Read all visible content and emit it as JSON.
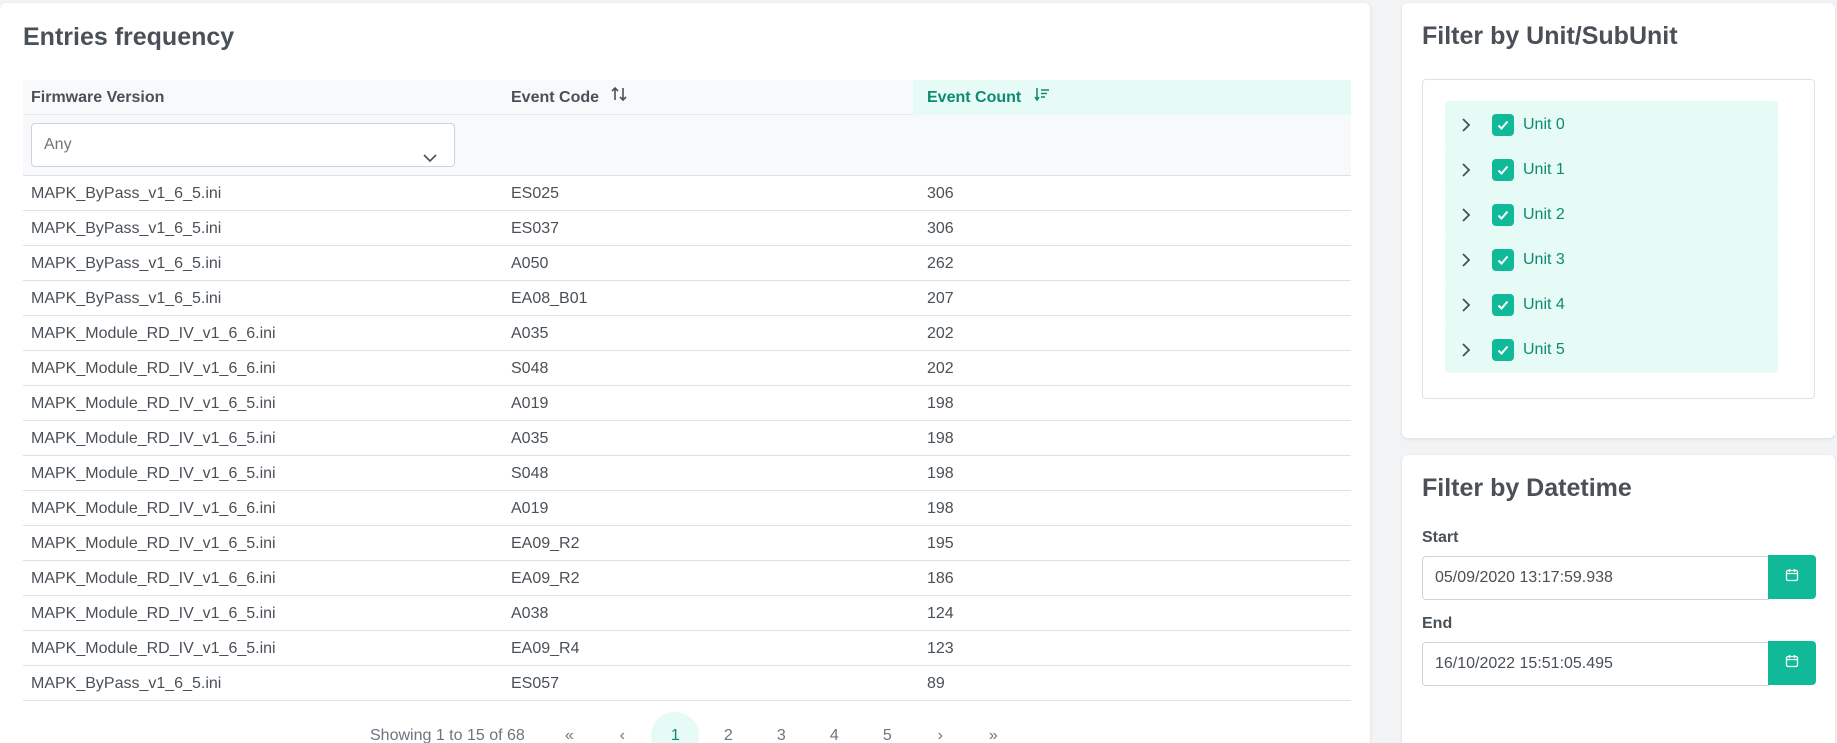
{
  "main": {
    "title": "Entries frequency",
    "columns": [
      "Firmware Version",
      "Event Code",
      "Event Count"
    ],
    "filter_value": "Any",
    "rows": [
      {
        "firmware": "MAPK_ByPass_v1_6_5.ini",
        "code": "ES025",
        "count": "306"
      },
      {
        "firmware": "MAPK_ByPass_v1_6_5.ini",
        "code": "ES037",
        "count": "306"
      },
      {
        "firmware": "MAPK_ByPass_v1_6_5.ini",
        "code": "A050",
        "count": "262"
      },
      {
        "firmware": "MAPK_ByPass_v1_6_5.ini",
        "code": "EA08_B01",
        "count": "207"
      },
      {
        "firmware": "MAPK_Module_RD_IV_v1_6_6.ini",
        "code": "A035",
        "count": "202"
      },
      {
        "firmware": "MAPK_Module_RD_IV_v1_6_6.ini",
        "code": "S048",
        "count": "202"
      },
      {
        "firmware": "MAPK_Module_RD_IV_v1_6_5.ini",
        "code": "A019",
        "count": "198"
      },
      {
        "firmware": "MAPK_Module_RD_IV_v1_6_5.ini",
        "code": "A035",
        "count": "198"
      },
      {
        "firmware": "MAPK_Module_RD_IV_v1_6_5.ini",
        "code": "S048",
        "count": "198"
      },
      {
        "firmware": "MAPK_Module_RD_IV_v1_6_6.ini",
        "code": "A019",
        "count": "198"
      },
      {
        "firmware": "MAPK_Module_RD_IV_v1_6_5.ini",
        "code": "EA09_R2",
        "count": "195"
      },
      {
        "firmware": "MAPK_Module_RD_IV_v1_6_6.ini",
        "code": "EA09_R2",
        "count": "186"
      },
      {
        "firmware": "MAPK_Module_RD_IV_v1_6_5.ini",
        "code": "A038",
        "count": "124"
      },
      {
        "firmware": "MAPK_Module_RD_IV_v1_6_5.ini",
        "code": "EA09_R4",
        "count": "123"
      },
      {
        "firmware": "MAPK_ByPass_v1_6_5.ini",
        "code": "ES057",
        "count": "89"
      }
    ],
    "pagination": {
      "info": "Showing 1 to 15 of 68",
      "first": "«",
      "prev": "‹",
      "pages": [
        "1",
        "2",
        "3",
        "4",
        "5"
      ],
      "active_page": "1",
      "next": "›",
      "last": "»"
    }
  },
  "unit_filter": {
    "title": "Filter by Unit/SubUnit",
    "units": [
      "Unit 0",
      "Unit 1",
      "Unit 2",
      "Unit 3",
      "Unit 4",
      "Unit 5"
    ]
  },
  "date_filter": {
    "title": "Filter by Datetime",
    "start_label": "Start",
    "start_value": "05/09/2020 13:17:59.938",
    "end_label": "End",
    "end_value": "16/10/2022 15:51:05.495"
  },
  "colors": {
    "accent": "#10b998",
    "accent_light": "#e6fbf6",
    "accent_text": "#0d8a72"
  }
}
